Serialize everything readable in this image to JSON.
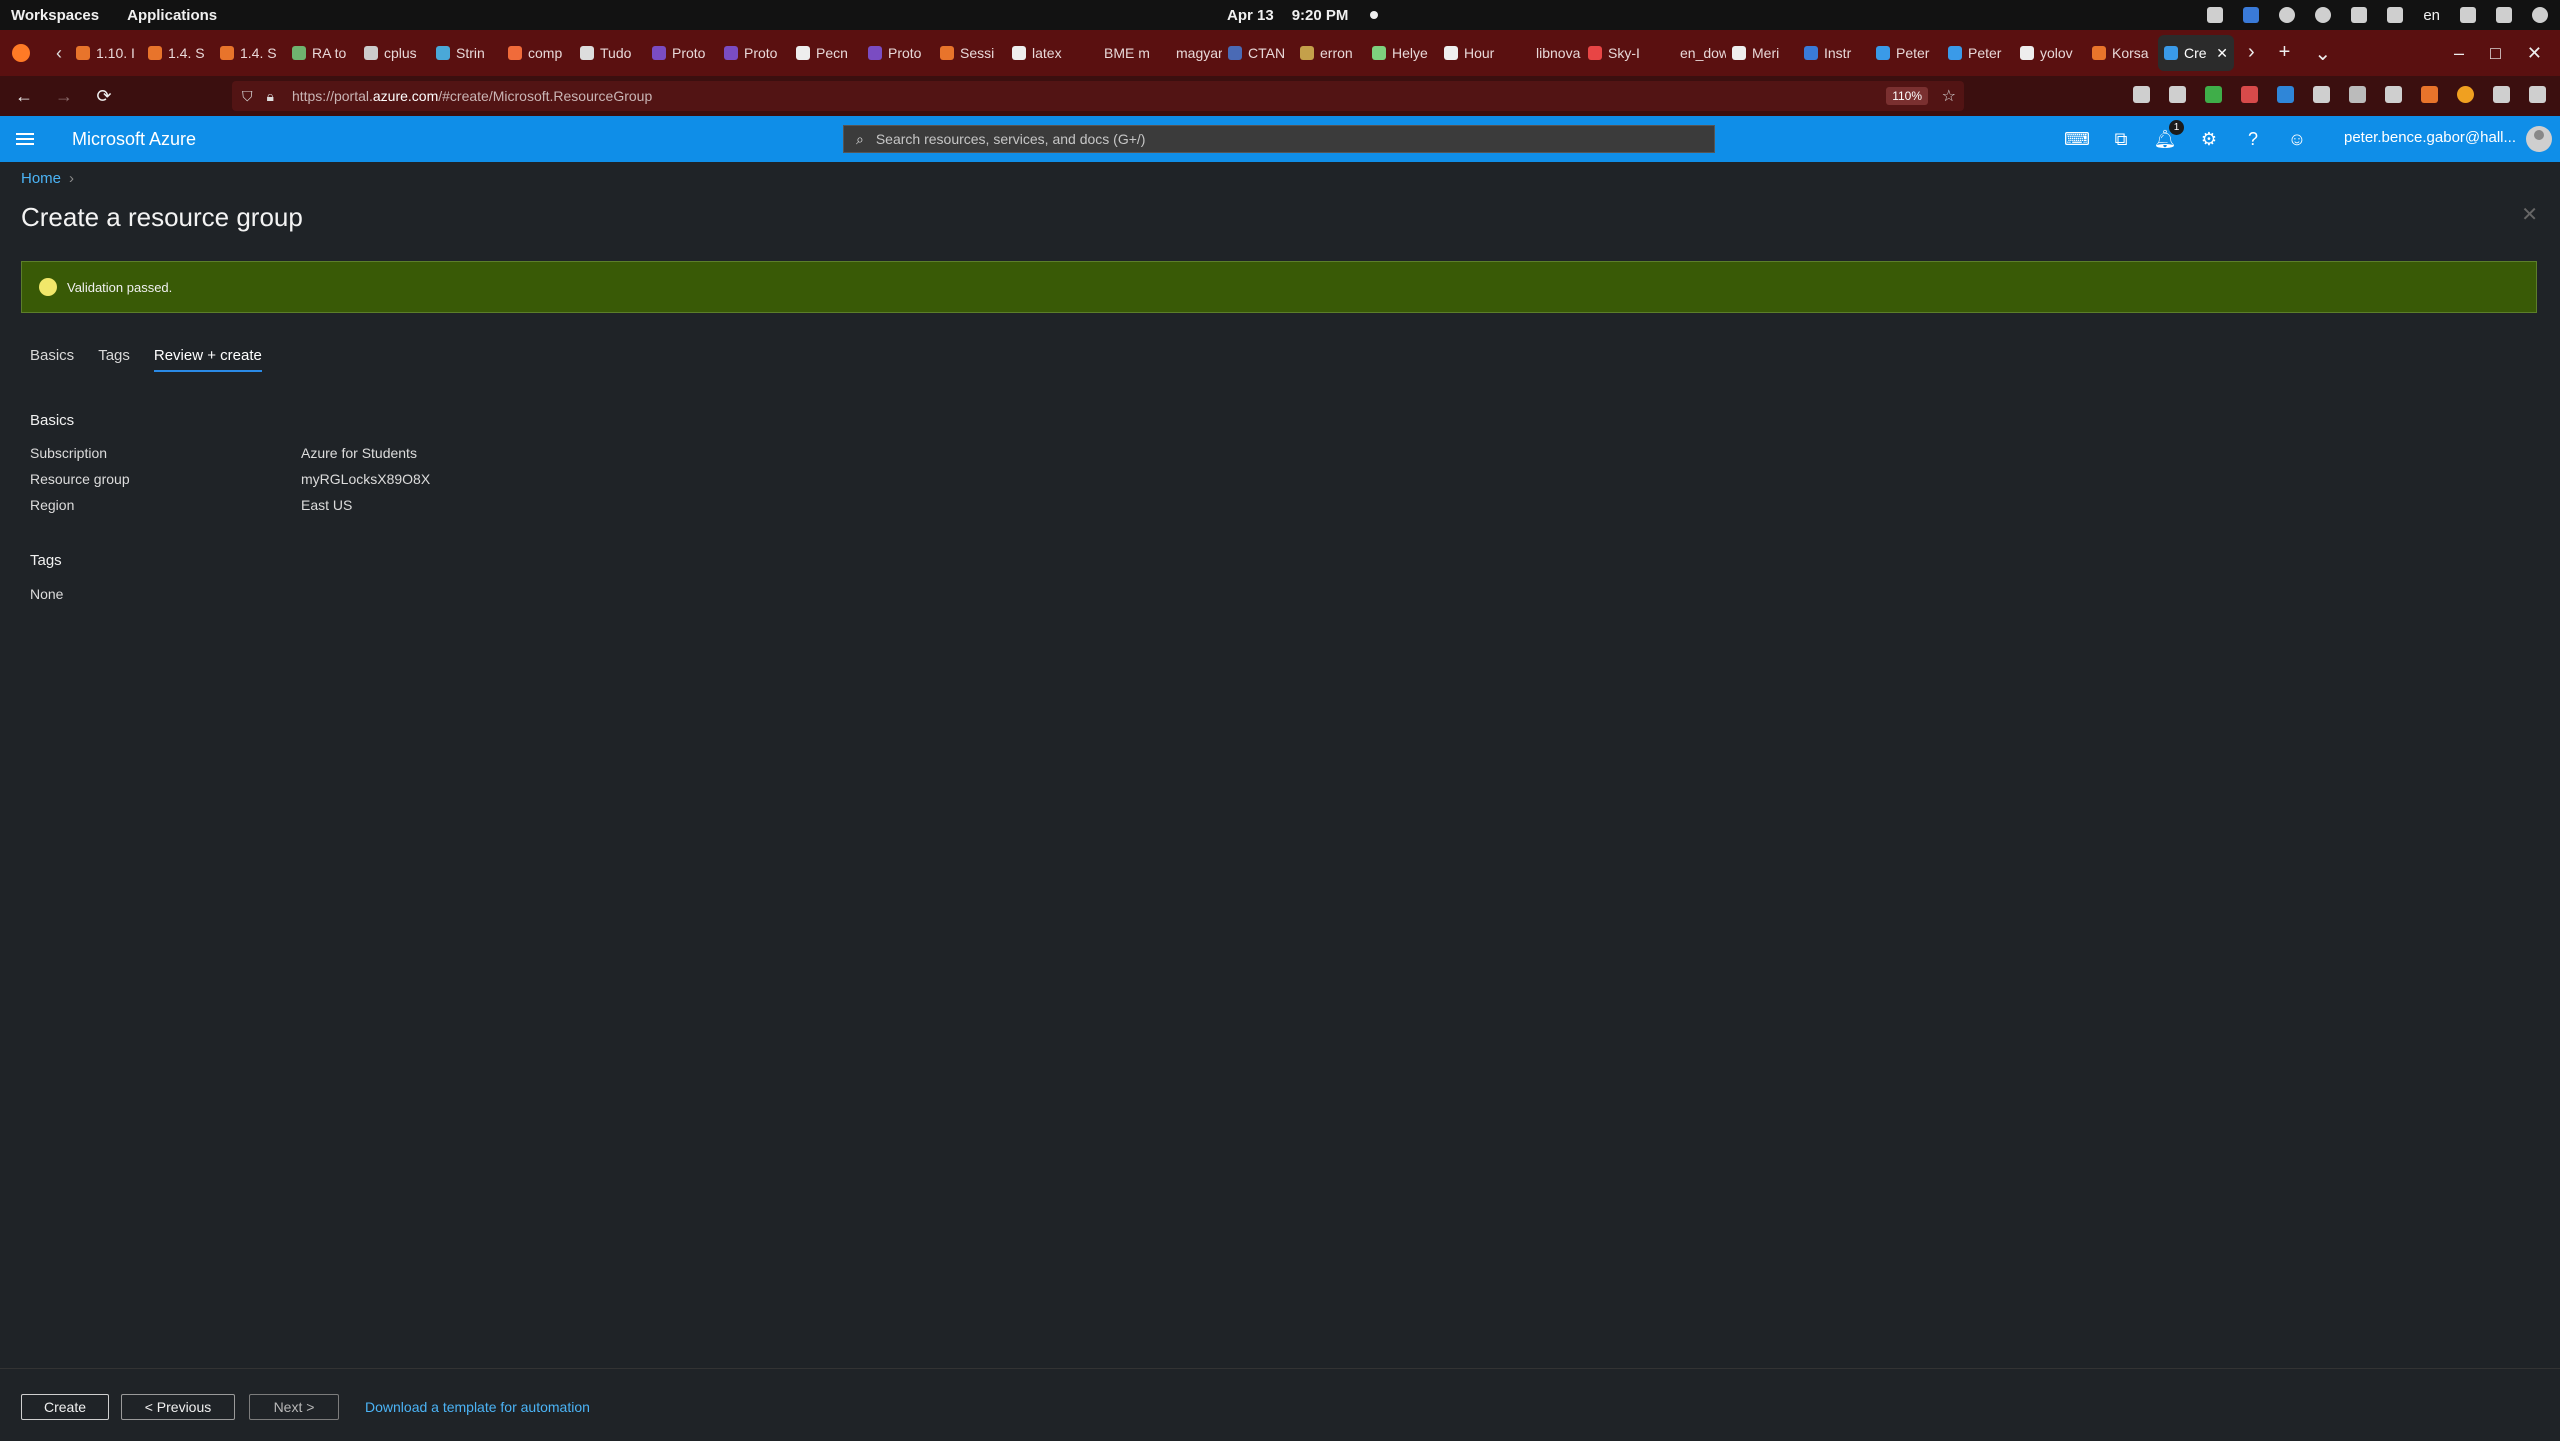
{
  "system_bar": {
    "workspaces": "Workspaces",
    "applications": "Applications",
    "date": "Apr 13",
    "time": "9:20 PM",
    "language": "en"
  },
  "browser": {
    "tabs": [
      {
        "label": "1.10. I",
        "color": "#e8742b"
      },
      {
        "label": "1.4. S",
        "color": "#e8742b"
      },
      {
        "label": "1.4. S",
        "color": "#e8742b"
      },
      {
        "label": "RA to",
        "color": "#6fb36f"
      },
      {
        "label": "cplus",
        "color": "#cccccc"
      },
      {
        "label": "Strin",
        "color": "#4aa8d8"
      },
      {
        "label": "comp",
        "color": "#f06b3a"
      },
      {
        "label": "Tudo",
        "color": "#dddddd"
      },
      {
        "label": "Proto",
        "color": "#7a4cc2"
      },
      {
        "label": "Proto",
        "color": "#7a4cc2"
      },
      {
        "label": "Pecn",
        "color": "#eeeeee"
      },
      {
        "label": "Proto",
        "color": "#7a4cc2"
      },
      {
        "label": "Sessi",
        "color": "#e8742b"
      },
      {
        "label": "latex",
        "color": "#eeeeee"
      },
      {
        "label": "BME mat",
        "color": "#5a1010"
      },
      {
        "label": "magyarlo",
        "color": "#5a1010"
      },
      {
        "label": "CTAN",
        "color": "#4a6ab5"
      },
      {
        "label": "erron",
        "color": "#c4a04a"
      },
      {
        "label": "Helye",
        "color": "#7ed07e"
      },
      {
        "label": "Hour",
        "color": "#eeeeee"
      },
      {
        "label": "libnova",
        "color": "#5a1010"
      },
      {
        "label": "Sky-I",
        "color": "#e84545"
      },
      {
        "label": "en_down",
        "color": "#5a1010"
      },
      {
        "label": "Meri",
        "color": "#eeeeee"
      },
      {
        "label": "Instr",
        "color": "#3a7ad8"
      },
      {
        "label": "Peter",
        "color": "#3a9ae8"
      },
      {
        "label": "Peter",
        "color": "#3a9ae8"
      },
      {
        "label": "yolov",
        "color": "#eeeeee"
      },
      {
        "label": "Korsa",
        "color": "#e8742b"
      }
    ],
    "active_tab": {
      "label": "Cre",
      "color": "#3a9ae8"
    },
    "url_prefix": "https://portal.",
    "url_domain": "azure.com",
    "url_path": "/#create/Microsoft.ResourceGroup",
    "zoom": "110%"
  },
  "azure_header": {
    "brand": "Microsoft Azure",
    "search_placeholder": "Search resources, services, and docs (G+/)",
    "notification_count": "1",
    "account": "peter.bence.gabor@hall..."
  },
  "page": {
    "breadcrumb_home": "Home",
    "title": "Create a resource group",
    "validation_message": "Validation passed.",
    "tabs": [
      "Basics",
      "Tags",
      "Review + create"
    ],
    "basics_heading": "Basics",
    "basics": [
      {
        "label": "Subscription",
        "value": "Azure for Students"
      },
      {
        "label": "Resource group",
        "value": "myRGLocksX89O8X"
      },
      {
        "label": "Region",
        "value": "East US"
      }
    ],
    "tags_heading": "Tags",
    "tags_value": "None"
  },
  "footer": {
    "create": "Create",
    "previous": "< Previous",
    "next": "Next >",
    "download_link": "Download a template for automation"
  },
  "colors": {
    "azure_blue": "#0f8ee8",
    "validation_green": "#395a06",
    "link_blue": "#4bb3f5",
    "tab_strip": "#5a1010"
  }
}
